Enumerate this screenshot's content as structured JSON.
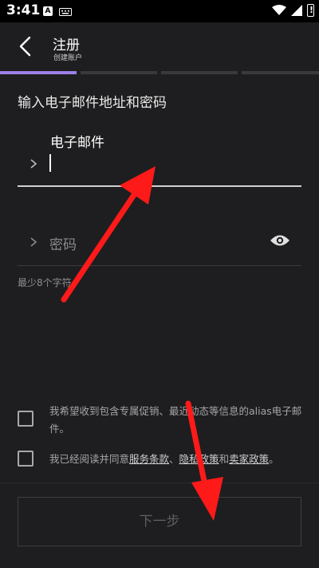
{
  "status_bar": {
    "time": "3:41",
    "notification_letter": "A"
  },
  "header": {
    "title": "注册",
    "subtitle": "创建账户"
  },
  "progress": {
    "total_steps": 4,
    "current_step": 1
  },
  "form": {
    "heading": "输入电子邮件地址和密码",
    "email": {
      "label": "电子邮件",
      "value": ""
    },
    "password": {
      "placeholder": "密码",
      "hint": "最少8个字符"
    }
  },
  "checkboxes": {
    "marketing": {
      "text": "我希望收到包含专属促销、最近动态等信息的alias电子邮件。",
      "checked": false
    },
    "terms": {
      "checked": false,
      "prefix": "我已经阅读并同意",
      "link1": "服务条款",
      "sep1": "、",
      "link2": "隐私政策",
      "sep2": "和",
      "link3": "卖家政策",
      "suffix": "。"
    }
  },
  "next_button": {
    "label": "下一步",
    "enabled": false
  },
  "colors": {
    "accent": "#9b7fe6",
    "background": "#1e1e20",
    "annotation_arrow": "#ff1a1a"
  }
}
